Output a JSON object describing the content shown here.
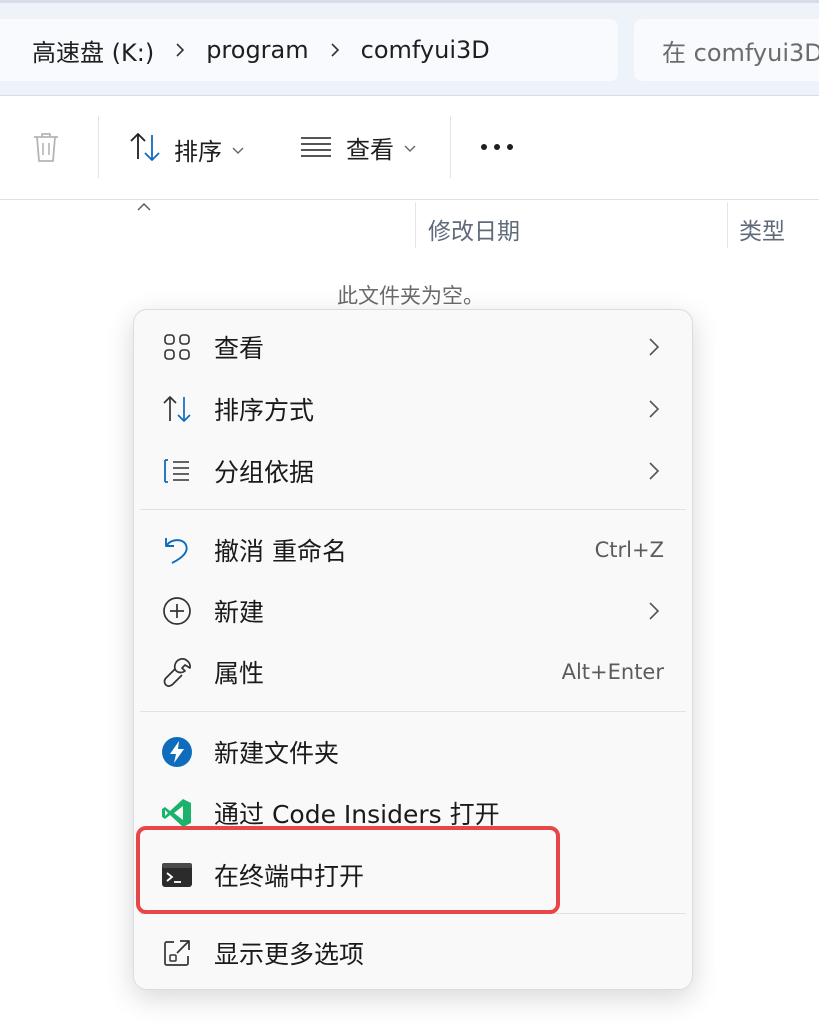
{
  "breadcrumb": {
    "items": [
      "高速盘 (K:)",
      "program",
      "comfyui3D"
    ]
  },
  "search": {
    "placeholder": "在 comfyui3D"
  },
  "toolbar": {
    "sort_label": "排序",
    "view_label": "查看"
  },
  "columns": {
    "modified": "修改日期",
    "type": "类型"
  },
  "empty_message": "此文件夹为空。",
  "context_menu": {
    "items": [
      {
        "label": "查看",
        "icon": "grid-icon",
        "submenu": true
      },
      {
        "label": "排序方式",
        "icon": "sort-icon",
        "submenu": true
      },
      {
        "label": "分组依据",
        "icon": "group-list-icon",
        "submenu": true
      },
      {
        "label": "撤消 重命名",
        "icon": "undo-icon",
        "shortcut": "Ctrl+Z"
      },
      {
        "label": "新建",
        "icon": "new-plus-icon",
        "submenu": true
      },
      {
        "label": "属性",
        "icon": "wrench-icon",
        "shortcut": "Alt+Enter"
      },
      {
        "label": "新建文件夹",
        "icon": "lightning-app-icon"
      },
      {
        "label": "通过 Code Insiders 打开",
        "icon": "vscode-insiders-icon"
      },
      {
        "label": "在终端中打开",
        "icon": "terminal-icon",
        "highlighted": true
      },
      {
        "label": "显示更多选项",
        "icon": "share-expand-icon"
      }
    ]
  },
  "colors": {
    "highlight_border": "#e8474a",
    "accent": "#0f6cbd",
    "code_insiders_green": "#1bb36b"
  }
}
